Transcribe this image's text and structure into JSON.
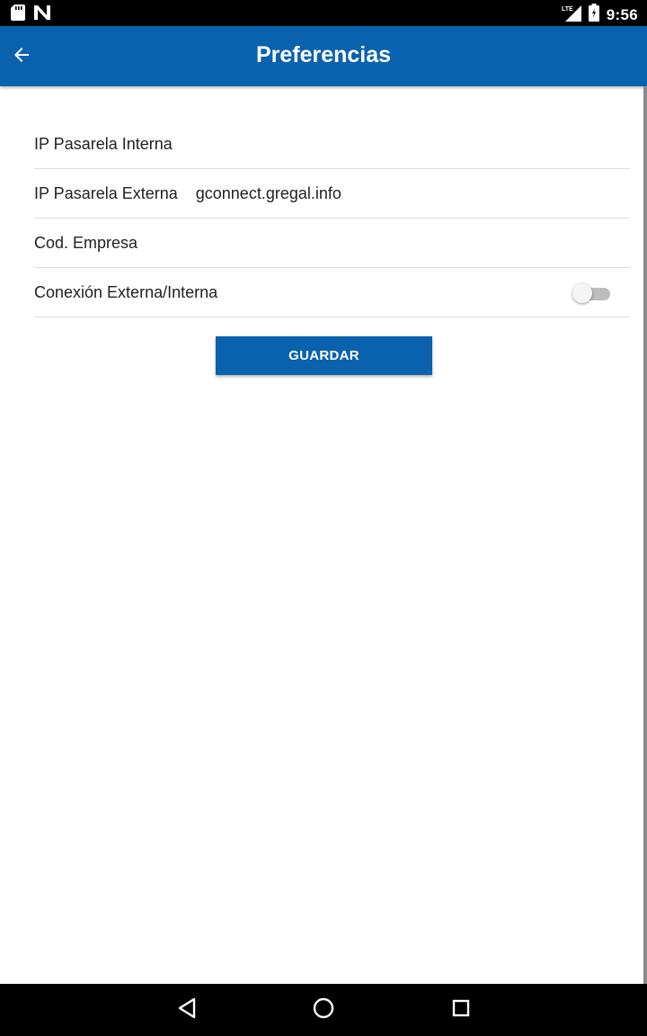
{
  "status_bar": {
    "time": "9:56",
    "network": "LTE",
    "left_icons": [
      "sd-card-icon",
      "notification-n-icon"
    ],
    "right_icons": [
      "signal-icon",
      "battery-icon"
    ]
  },
  "app_bar": {
    "title": "Preferencias",
    "back_icon": "arrow-back-icon",
    "color": "#0a62ae"
  },
  "settings": {
    "rows": [
      {
        "label": "IP Pasarela Interna",
        "value": ""
      },
      {
        "label": "IP Pasarela Externa",
        "value": "gconnect.gregal.info"
      },
      {
        "label": "Cod. Empresa",
        "value": ""
      },
      {
        "label": "Conexión Externa/Interna",
        "toggle_on": false
      }
    ]
  },
  "actions": {
    "save_label": "GUARDAR"
  },
  "nav_bar": {
    "icons": [
      "back-triangle-icon",
      "home-circle-icon",
      "recents-square-icon"
    ]
  }
}
